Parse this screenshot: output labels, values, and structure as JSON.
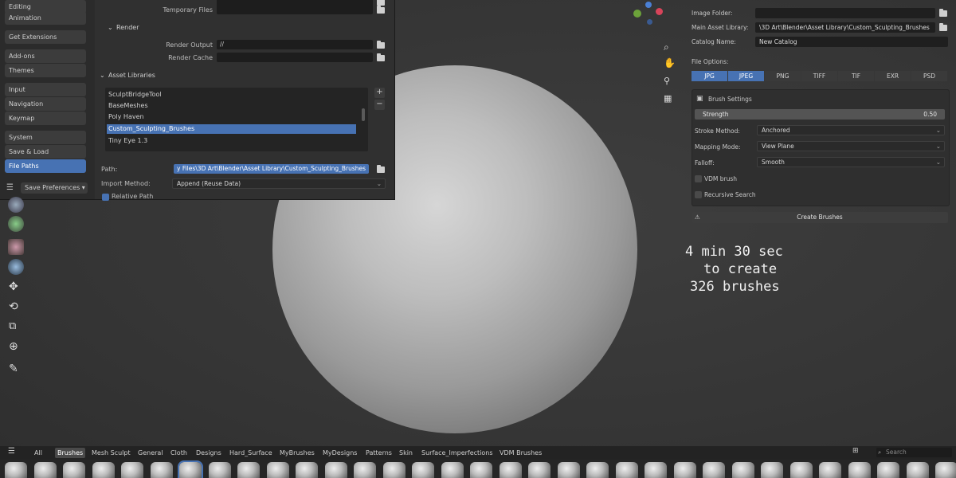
{
  "prefs": {
    "nav": [
      {
        "label": "Editing"
      },
      {
        "label": "Animation"
      },
      {
        "label": "Get Extensions"
      },
      {
        "label": "Add-ons"
      },
      {
        "label": "Themes"
      },
      {
        "label": "Input"
      },
      {
        "label": "Navigation"
      },
      {
        "label": "Keymap"
      },
      {
        "label": "System"
      },
      {
        "label": "Save & Load"
      },
      {
        "label": "File Paths"
      }
    ],
    "save_prefs_label": "Save Preferences ▾",
    "temporary_files_label": "Temporary Files",
    "render_section": "Render",
    "render_output_label": "Render Output",
    "render_output_value": "//",
    "render_cache_label": "Render Cache",
    "asset_libraries_section": "Asset Libraries",
    "libraries": [
      "SculptBridgeTool",
      "BaseMeshes",
      "Poly Haven",
      "Custom_Sculpting_Brushes",
      "Tiny Eye 1.3"
    ],
    "path_label": "Path:",
    "path_value": "y Files\\3D Art\\Blender\\Asset Library\\Custom_Sculpting_Brushes",
    "import_method_label": "Import Method:",
    "import_method_value": "Append (Reuse Data)",
    "relative_path_label": "Relative Path"
  },
  "panel": {
    "image_folder_label": "Image Folder:",
    "image_folder_value": "",
    "main_lib_label": "Main Asset Library:",
    "main_lib_value": "\\3D Art\\Blender\\Asset Library\\Custom_Sculpting_Brushes",
    "catalog_label": "Catalog Name:",
    "catalog_value": "New Catalog",
    "file_options_label": "File Options:",
    "formats": [
      "JPG",
      "JPEG",
      "PNG",
      "TIFF",
      "TIF",
      "EXR",
      "PSD"
    ],
    "brush_settings_label": "Brush Settings",
    "strength_label": "Strength",
    "strength_value": "0.50",
    "stroke_label": "Stroke Method:",
    "stroke_value": "Anchored",
    "mapping_label": "Mapping Mode:",
    "mapping_value": "View Plane",
    "falloff_label": "Falloff:",
    "falloff_value": "Smooth",
    "vdm_label": "VDM brush",
    "recursive_label": "Recursive Search",
    "create_label": "Create Brushes"
  },
  "overlay": {
    "line1": "4 min 30 sec",
    "line2": "to create",
    "line3": "326 brushes"
  },
  "tabs": [
    "All",
    "Brushes",
    "Mesh Sculpt",
    "General",
    "Cloth",
    "Designs",
    "Hard_Surface",
    "MyBrushes",
    "MyDesigns",
    "Patterns",
    "Skin",
    "Surface_Imperfections",
    "VDM Brushes"
  ],
  "search_placeholder": "Search"
}
